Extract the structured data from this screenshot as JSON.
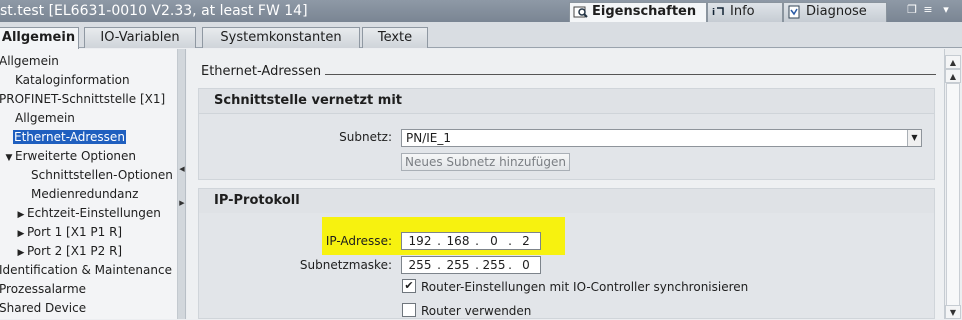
{
  "window": {
    "title": "st.test [EL6631-0010 V2.33, at least FW 14]",
    "tabs": [
      {
        "label": "Eigenschaften",
        "icon": "properties-icon"
      },
      {
        "label": "Info",
        "icon": "info-icon"
      },
      {
        "label": "Diagnose",
        "icon": "diagnostics-icon"
      }
    ],
    "controls": [
      "restore-icon",
      "menu-icon"
    ]
  },
  "top_tabs": [
    "Allgemein",
    "IO-Variablen",
    "Systemkonstanten",
    "Texte"
  ],
  "nav": {
    "items": [
      {
        "label": "Allgemein",
        "indent": 0,
        "arrow": ""
      },
      {
        "label": "Kataloginformation",
        "indent": 1,
        "arrow": ""
      },
      {
        "label": "PROFINET-Schnittstelle [X1]",
        "indent": 0,
        "arrow": ""
      },
      {
        "label": "Allgemein",
        "indent": 1,
        "arrow": ""
      },
      {
        "label": "Ethernet-Adressen",
        "indent": 1,
        "arrow": "",
        "selected": true
      },
      {
        "label": "Erweiterte Optionen",
        "indent": 1,
        "arrow": "down"
      },
      {
        "label": "Schnittstellen-Optionen",
        "indent": 2,
        "arrow": ""
      },
      {
        "label": "Medienredundanz",
        "indent": 2,
        "arrow": ""
      },
      {
        "label": "Echtzeit-Einstellungen",
        "indent": 2,
        "arrow": "right"
      },
      {
        "label": "Port 1 [X1 P1 R]",
        "indent": 2,
        "arrow": "right"
      },
      {
        "label": "Port 2 [X1 P2 R]",
        "indent": 2,
        "arrow": "right"
      },
      {
        "label": "Identification & Maintenance",
        "indent": 0,
        "arrow": ""
      },
      {
        "label": "Prozessalarme",
        "indent": 0,
        "arrow": ""
      },
      {
        "label": "Shared Device",
        "indent": 0,
        "arrow": ""
      }
    ]
  },
  "main": {
    "section_title": "Ethernet-Adressen",
    "network_group": {
      "title": "Schnittstelle vernetzt mit",
      "subnet_label": "Subnetz:",
      "subnet_value": "PN/IE_1",
      "add_subnet_button": "Neues Subnetz hinzufügen"
    },
    "ip_group": {
      "title": "IP-Protokoll",
      "ip_label": "IP-Adresse:",
      "ip": [
        "192",
        "168",
        "0",
        "2"
      ],
      "mask_label": "Subnetzmaske:",
      "mask": [
        "255",
        "255",
        "255",
        "0"
      ],
      "sync_router_label": "Router-Einstellungen mit IO-Controller synchronisieren",
      "sync_router_checked": true,
      "use_router_label": "Router verwenden",
      "use_router_checked": false
    }
  },
  "colors": {
    "selection": "#1f5fbf",
    "highlight": "#f7f20f"
  }
}
